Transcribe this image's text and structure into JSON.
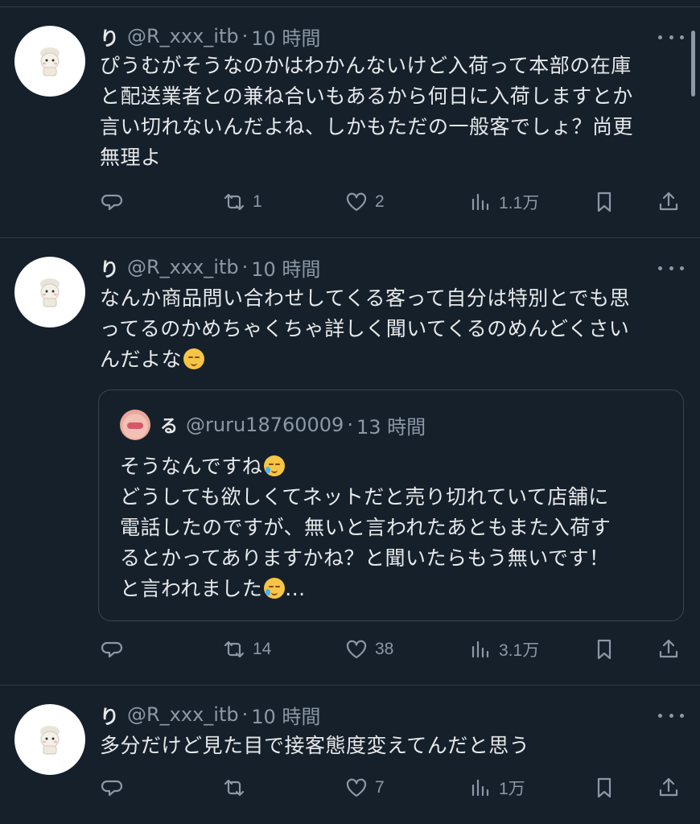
{
  "tweets": [
    {
      "name": "り",
      "handle": "@R_xxx_itb",
      "dot": "·",
      "time": "10 時間",
      "lines": [
        "ぴうむがそうなのかはわかんないけど入荷って本部の在庫",
        "と配送業者との兼ね合いもあるから何日に入荷しますとか",
        "言い切れないんだよね、しかもただの一般客でしょ？尚更",
        "無理よ"
      ],
      "replies": "",
      "retweets": "1",
      "likes": "2",
      "views": "1.1万"
    },
    {
      "name": "り",
      "handle": "@R_xxx_itb",
      "dot": "·",
      "time": "10 時間",
      "lines": [
        "なんか商品問い合わせしてくる客って自分は特別とでも思",
        "ってるのかめちゃくちゃ詳しく聞いてくるのめんどくさい",
        "んだよな"
      ],
      "emoji_after_last": "pensive-emoji",
      "quote": {
        "name": "る",
        "handle": "@ruru18760009",
        "dot": "·",
        "time": "13 時間",
        "lines": [
          "そうなんですね",
          "どうしても欲しくてネットだと売り切れていて店舗に",
          "電話したのですが、無いと言われたあともまた入荷す",
          "るとかってありますかね？と聞いたらもう無いです！",
          "と言われました",
          "..."
        ],
        "emoji": "crying-face-emoji"
      },
      "replies": "",
      "retweets": "14",
      "likes": "38",
      "views": "3.1万"
    },
    {
      "name": "り",
      "handle": "@R_xxx_itb",
      "dot": "·",
      "time": "10 時間",
      "lines": [
        "多分だけど見た目で接客態度変えてんだと思う"
      ],
      "replies": "",
      "retweets": "",
      "likes": "7",
      "views": "1万"
    }
  ],
  "icons": {
    "reply": "reply-icon",
    "retweet": "retweet-icon",
    "like": "heart-icon",
    "views": "views-icon",
    "bookmark": "bookmark-icon",
    "share": "share-icon",
    "more": "more-icon"
  },
  "colors": {
    "background": "#15202b",
    "text": "#e7e9ea",
    "secondary": "#8b98a5",
    "border": "#2f3b47"
  }
}
